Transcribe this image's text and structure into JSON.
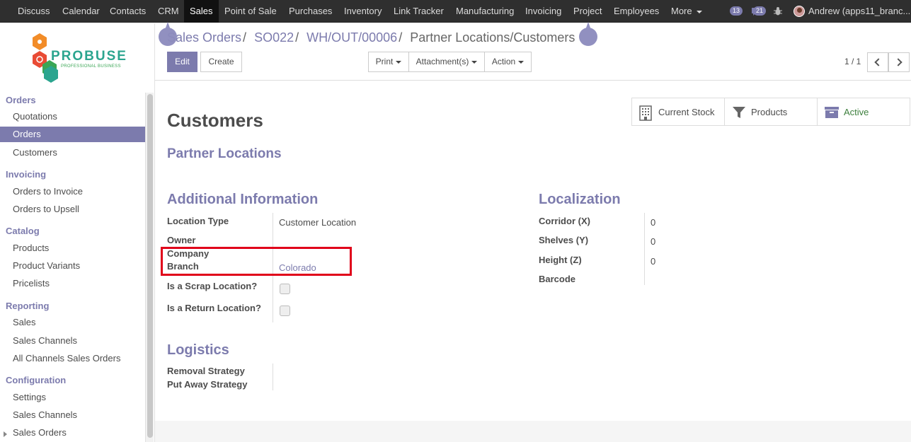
{
  "topbar": {
    "apps": [
      "Discuss",
      "Calendar",
      "Contacts",
      "CRM",
      "Sales",
      "Point of Sale",
      "Purchases",
      "Inventory",
      "Link Tracker",
      "Manufacturing",
      "Invoicing",
      "Project",
      "Employees",
      "More"
    ],
    "active_app": "Sales",
    "activity_count": "13",
    "message_count": "21",
    "user": "Andrew (apps11_branc..."
  },
  "sidebar": {
    "logo_text": "PROBUSE",
    "logo_tagline": "PROFESSIONAL BUSINESS",
    "sections": [
      {
        "title": "Orders",
        "items": [
          "Quotations",
          "Orders",
          "Customers"
        ]
      },
      {
        "title": "Invoicing",
        "items": [
          "Orders to Invoice",
          "Orders to Upsell"
        ]
      },
      {
        "title": "Catalog",
        "items": [
          "Products",
          "Product Variants",
          "Pricelists"
        ]
      },
      {
        "title": "Reporting",
        "items": [
          "Sales",
          "Sales Channels",
          "All Channels Sales Orders"
        ]
      },
      {
        "title": "Configuration",
        "items": [
          "Settings",
          "Sales Channels",
          "Sales Orders"
        ]
      }
    ],
    "active_item": "Orders"
  },
  "breadcrumb": [
    "Sales Orders",
    "SO022",
    "WH/OUT/00006",
    "Partner Locations/Customers"
  ],
  "buttons": {
    "edit": "Edit",
    "create": "Create",
    "print": "Print",
    "attachments": "Attachment(s)",
    "action": "Action"
  },
  "pager": "1 / 1",
  "stat_buttons": {
    "stock": "Current Stock",
    "products": "Products",
    "active": "Active"
  },
  "form": {
    "title": "Customers",
    "subtitle": "Partner Locations",
    "additional_info": {
      "title": "Additional Information",
      "location_type_label": "Location Type",
      "location_type_value": "Customer Location",
      "owner_label": "Owner",
      "company_label": "Company",
      "branch_label": "Branch",
      "branch_value": "Colorado",
      "scrap_label": "Is a Scrap Location?",
      "return_label": "Is a Return Location?"
    },
    "localization": {
      "title": "Localization",
      "corridor_label": "Corridor (X)",
      "corridor_value": "0",
      "shelves_label": "Shelves (Y)",
      "shelves_value": "0",
      "height_label": "Height (Z)",
      "height_value": "0",
      "barcode_label": "Barcode"
    },
    "logistics": {
      "title": "Logistics",
      "removal_label": "Removal Strategy",
      "putaway_label": "Put Away Strategy"
    }
  },
  "colors": {
    "accent": "#7c7bad",
    "topbar": "#2f2f2f",
    "active_green": "#3d7f3d",
    "highlight_red": "#e0001a"
  }
}
